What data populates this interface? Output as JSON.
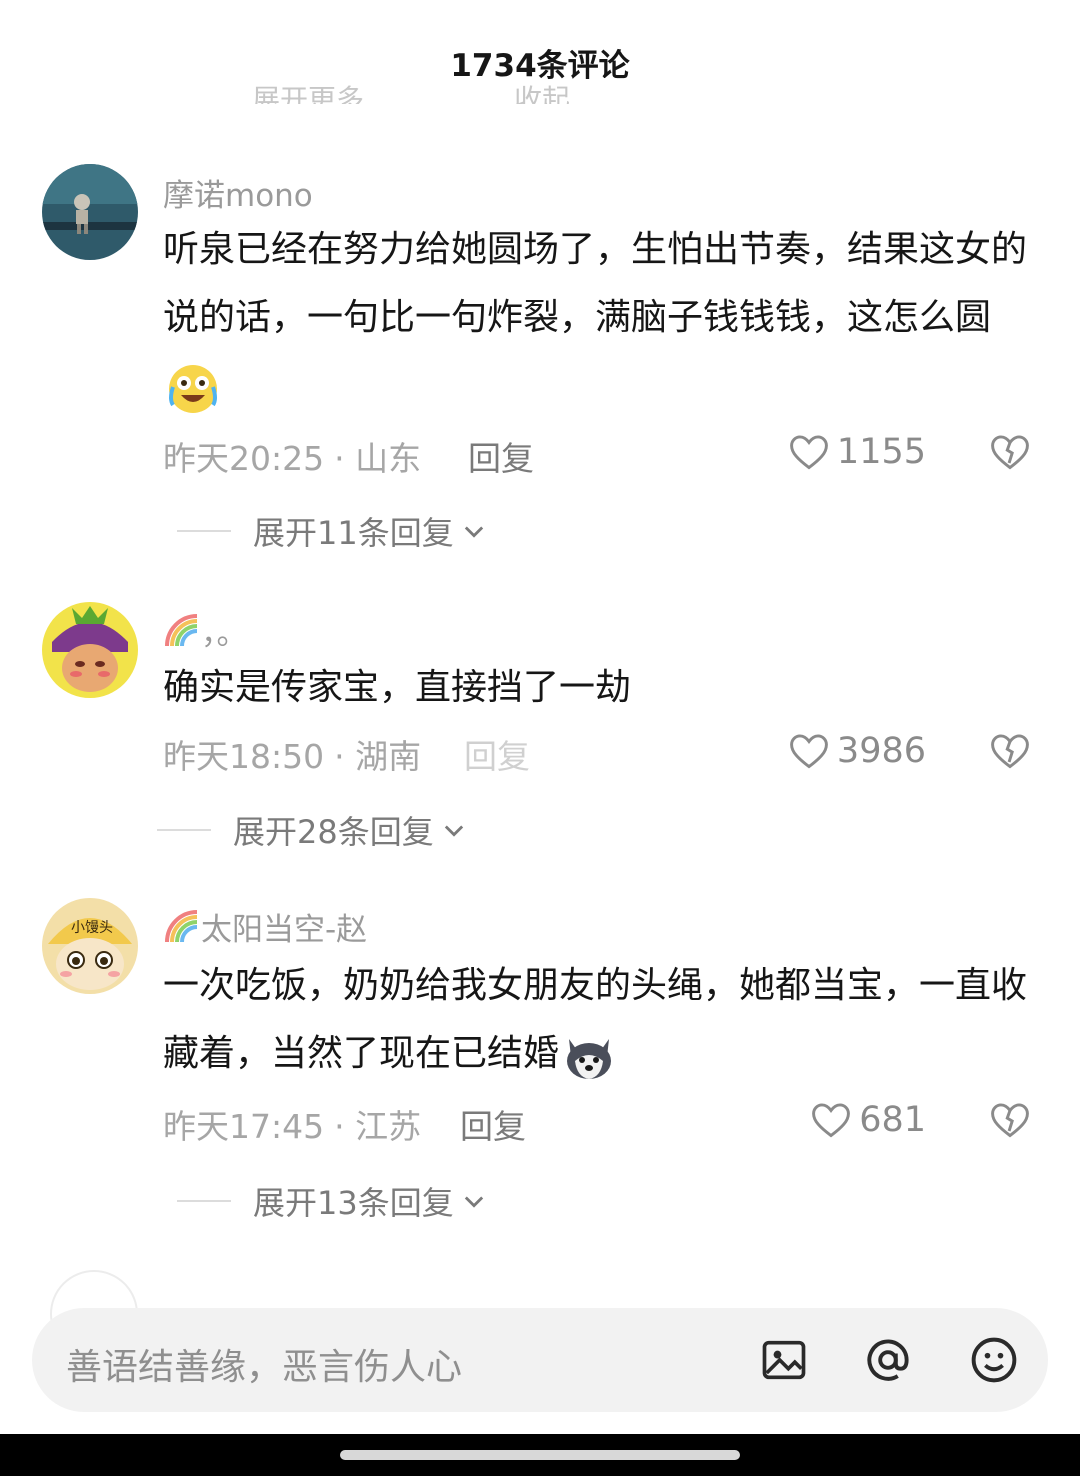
{
  "header": {
    "title": "1734条评论",
    "ghost_left": "展开更多",
    "ghost_right": "收起"
  },
  "comments": [
    {
      "username": "摩诺mono",
      "text": "听泉已经在努力给她圆场了，生怕出节奏，结果这女的说的话，一句比一句炸裂，满脑子钱钱钱，这怎么圆",
      "emoji": "laughing-crying-emoji",
      "time": "昨天20:25",
      "location": "· 山东",
      "reply_label": "回复",
      "likes": "1155",
      "expand_label": "展开11条回复"
    },
    {
      "username": "，。",
      "username_prefix_icon": "rainbow-icon",
      "text": "确实是传家宝，直接挡了一劫",
      "time": "昨天18:50",
      "location": "· 湖南",
      "reply_label": "回复",
      "likes": "3986",
      "expand_label": "展开28条回复"
    },
    {
      "username": "太阳当空-赵",
      "username_prefix_icon": "rainbow-icon",
      "avatar_text": "小馒头",
      "text": "一次吃饭，奶奶给我女朋友的头绳，她都当宝，一直收藏着，当然了现在已结婚",
      "emoji": "husky-dog-emoji",
      "time": "昨天17:45",
      "location": "· 江苏",
      "reply_label": "回复",
      "likes": "681",
      "expand_label": "展开13条回复"
    }
  ],
  "input_bar": {
    "placeholder": "善语结善缘，恶言伤人心",
    "icons": [
      "image-icon",
      "at-icon",
      "emoji-icon"
    ]
  },
  "colors": {
    "background": "#ffffff",
    "text_primary": "#161616",
    "text_secondary": "#9a9a9a",
    "input_background": "#f2f2f2"
  }
}
